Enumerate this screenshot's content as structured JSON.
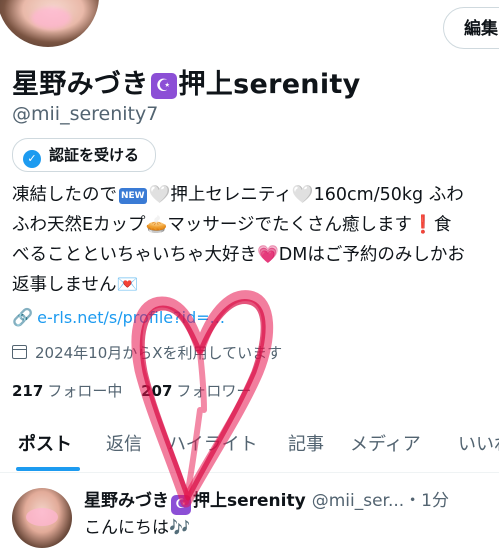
{
  "header": {
    "edit_button_label": "編集",
    "display_name_pre": "星野みづき",
    "moon_icon": "☪",
    "display_name_post": "押上serenity",
    "handle": "@mii_serenity7",
    "verify_label": "認証を受ける"
  },
  "bio": {
    "line1_a": "凍結したので",
    "new_badge": "NEW",
    "white_heart": "🤍",
    "line1_b": "押上セレニティ",
    "line1_c": "160cm/50kg ふわ",
    "line2_a": "ふわ天然Eカップ",
    "pie": "🥧",
    "line2_b": "マッサージでたくさん癒します",
    "exclaim": "❗",
    "line2_c": "食",
    "line3_a": "べることといちゃいちゃ大好き",
    "purple_heart": "💗",
    "line3_b": "DMはご予約のみしかお",
    "line4_a": "返事しません",
    "letter": "💌"
  },
  "link": {
    "icon": "link-icon",
    "text": "e-rls.net/s/profile?id=..."
  },
  "joined": {
    "text": "2024年10月からXを利用しています"
  },
  "follow": {
    "following_count": "217",
    "following_label": "フォロー中",
    "followers_count": "207",
    "followers_label": "フォロワー"
  },
  "tabs": [
    "ポスト",
    "返信",
    "ハイライト",
    "記事",
    "メディア",
    "いいね"
  ],
  "post": {
    "name_pre": "星野みづき",
    "name_post": "押上serenity",
    "handle_time": "@mii_ser...・1分",
    "text": "こんにちは🎶"
  },
  "colors": {
    "accent": "#1d9bf0",
    "heart_overlay": "#e8144e",
    "moon_badge": "#8c4fd6"
  }
}
